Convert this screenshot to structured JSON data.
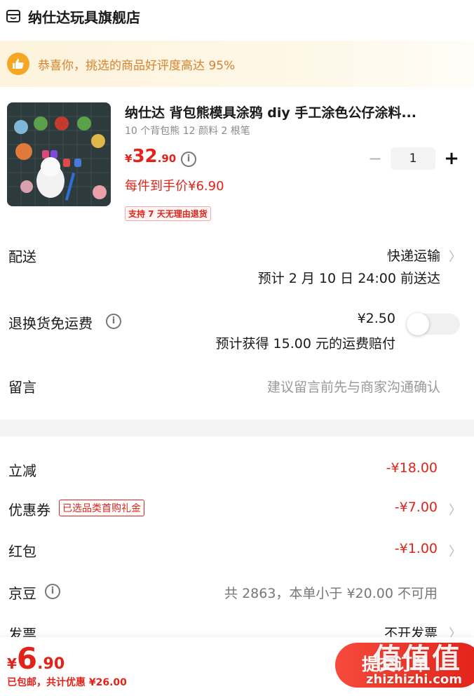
{
  "store": {
    "name": "纳仕达玩具旗舰店",
    "icon": "store-icon"
  },
  "banner": {
    "icon": "thumbs-up-icon",
    "text": "恭喜你，挑选的商品好评度高达 95%"
  },
  "product": {
    "title": "纳仕达 背包熊模具涂鸦 diy 手工涂色公仔涂料...",
    "spec": "10 个背包熊 12 颜料 2 根笔",
    "price_symbol": "¥",
    "price_integer": "32",
    "price_decimal": ".90",
    "unit_price": "每件到手价¥6.90",
    "return_badge": "支持 7 天无理由退货",
    "quantity": "1",
    "minus": "−",
    "plus": "+"
  },
  "delivery": {
    "label": "配送",
    "method": "快递运输",
    "estimate": "预计 2 月 10 日 24:00 前送达"
  },
  "return_shipping": {
    "label": "退换货免运费",
    "price": "¥2.50",
    "note": "预计获得 15.00 元的运费赔付",
    "enabled": false
  },
  "message": {
    "label": "留言",
    "placeholder": "建议留言前先与商家沟通确认"
  },
  "discounts": {
    "instant": {
      "label": "立减",
      "value": "-¥18.00"
    },
    "coupon": {
      "label": "优惠券",
      "tag": "已选品类首购礼金",
      "value": "-¥7.00"
    },
    "red_packet": {
      "label": "红包",
      "value": "-¥1.00"
    },
    "jd_beans": {
      "label": "京豆",
      "value": "共 2863，本单小于 ¥20.00 不可用"
    },
    "invoice": {
      "label": "发票",
      "value": "不开发票"
    }
  },
  "footer": {
    "total_symbol": "¥",
    "total_integer": "6",
    "total_decimal": ".90",
    "note": "已包邮，共计优惠 ¥26.00",
    "submit_label": "提交订单"
  },
  "watermark": {
    "logo": "值值值",
    "url": "zhizhizhi.com"
  },
  "colors": {
    "accent": "#e2231a",
    "banner_text": "#d9822b",
    "banner_bg": "#fdf3dc"
  }
}
